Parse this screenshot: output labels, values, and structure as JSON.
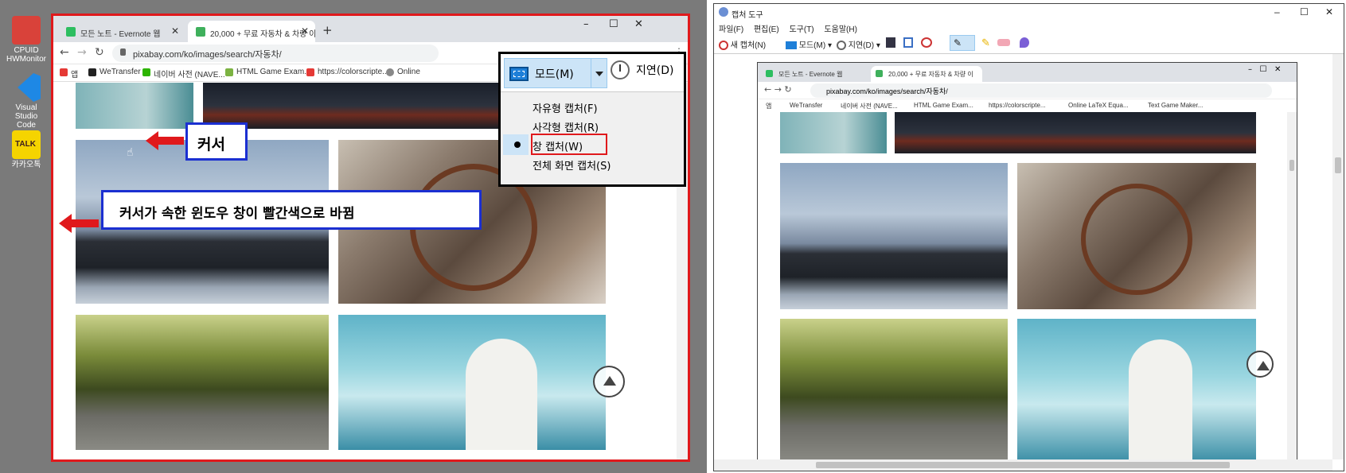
{
  "desktop": {
    "icons": [
      {
        "label": "CPUID\nHWMonitor",
        "color": "#d9423a"
      },
      {
        "label": "Visual Studio\nCode",
        "color": "#1e88e5"
      },
      {
        "label": "카카오톡",
        "color": "#f5d400",
        "badge": "TALK"
      }
    ]
  },
  "browser": {
    "tabs": [
      {
        "title": "모든 노트 - Evernote 웹",
        "favicon_color": "#2dbe60"
      },
      {
        "title": "20,000 + 무료 자동차 & 차량 이",
        "favicon_color": "#3fb05c",
        "favicon_text": "PX"
      }
    ],
    "new_tab": "+",
    "window_buttons": [
      "–",
      "☐",
      "✕"
    ],
    "url": "pixabay.com/ko/images/search/자동차/",
    "menu_icon": "⋮",
    "bookmarks": [
      {
        "label": "앱",
        "color": "#e53935"
      },
      {
        "label": "WeTransfer",
        "color": "#222222"
      },
      {
        "label": "네이버 사전 (NAVE...",
        "color": "#2db400"
      },
      {
        "label": "HTML Game Exam...",
        "color": "#7cb342"
      },
      {
        "label": "https://colorscripte...",
        "color": "#e53935"
      },
      {
        "label": "Online",
        "color": "#888888"
      }
    ],
    "more_bookmarks": "»"
  },
  "capture_menu": {
    "mode_label": "모드(M)",
    "delay_label": "지연(D)",
    "items": [
      "자유형 캡처(F)",
      "사각형 캡처(R)",
      "창 캡처(W)",
      "전체 화면 캡처(S)"
    ],
    "selected_index": 2
  },
  "annotations": {
    "cursor": "커서",
    "window_note": "커서가 속한 윈도우 창이 빨간색으로 바뀜"
  },
  "snip_app": {
    "title": "캡처 도구",
    "window_buttons": [
      "–",
      "☐",
      "✕"
    ],
    "menu": [
      "파일(F)",
      "편집(E)",
      "도구(T)",
      "도움말(H)"
    ],
    "toolbar": {
      "new": "새 캡처(N)",
      "mode": "모드(M)",
      "delay": "지연(D)"
    }
  },
  "captured": {
    "tabs": [
      {
        "title": "모든 노트 - Evernote 웹"
      },
      {
        "title": "20,000 + 무료 자동차 & 차량 이"
      }
    ],
    "url": "pixabay.com/ko/images/search/자동차/",
    "bookmarks": [
      "앱",
      "WeTransfer",
      "네이버 사전 (NAVE...",
      "HTML Game Exam...",
      "https://colorscripte...",
      "Online LaTeX Equa...",
      "Text Game Maker..."
    ]
  }
}
